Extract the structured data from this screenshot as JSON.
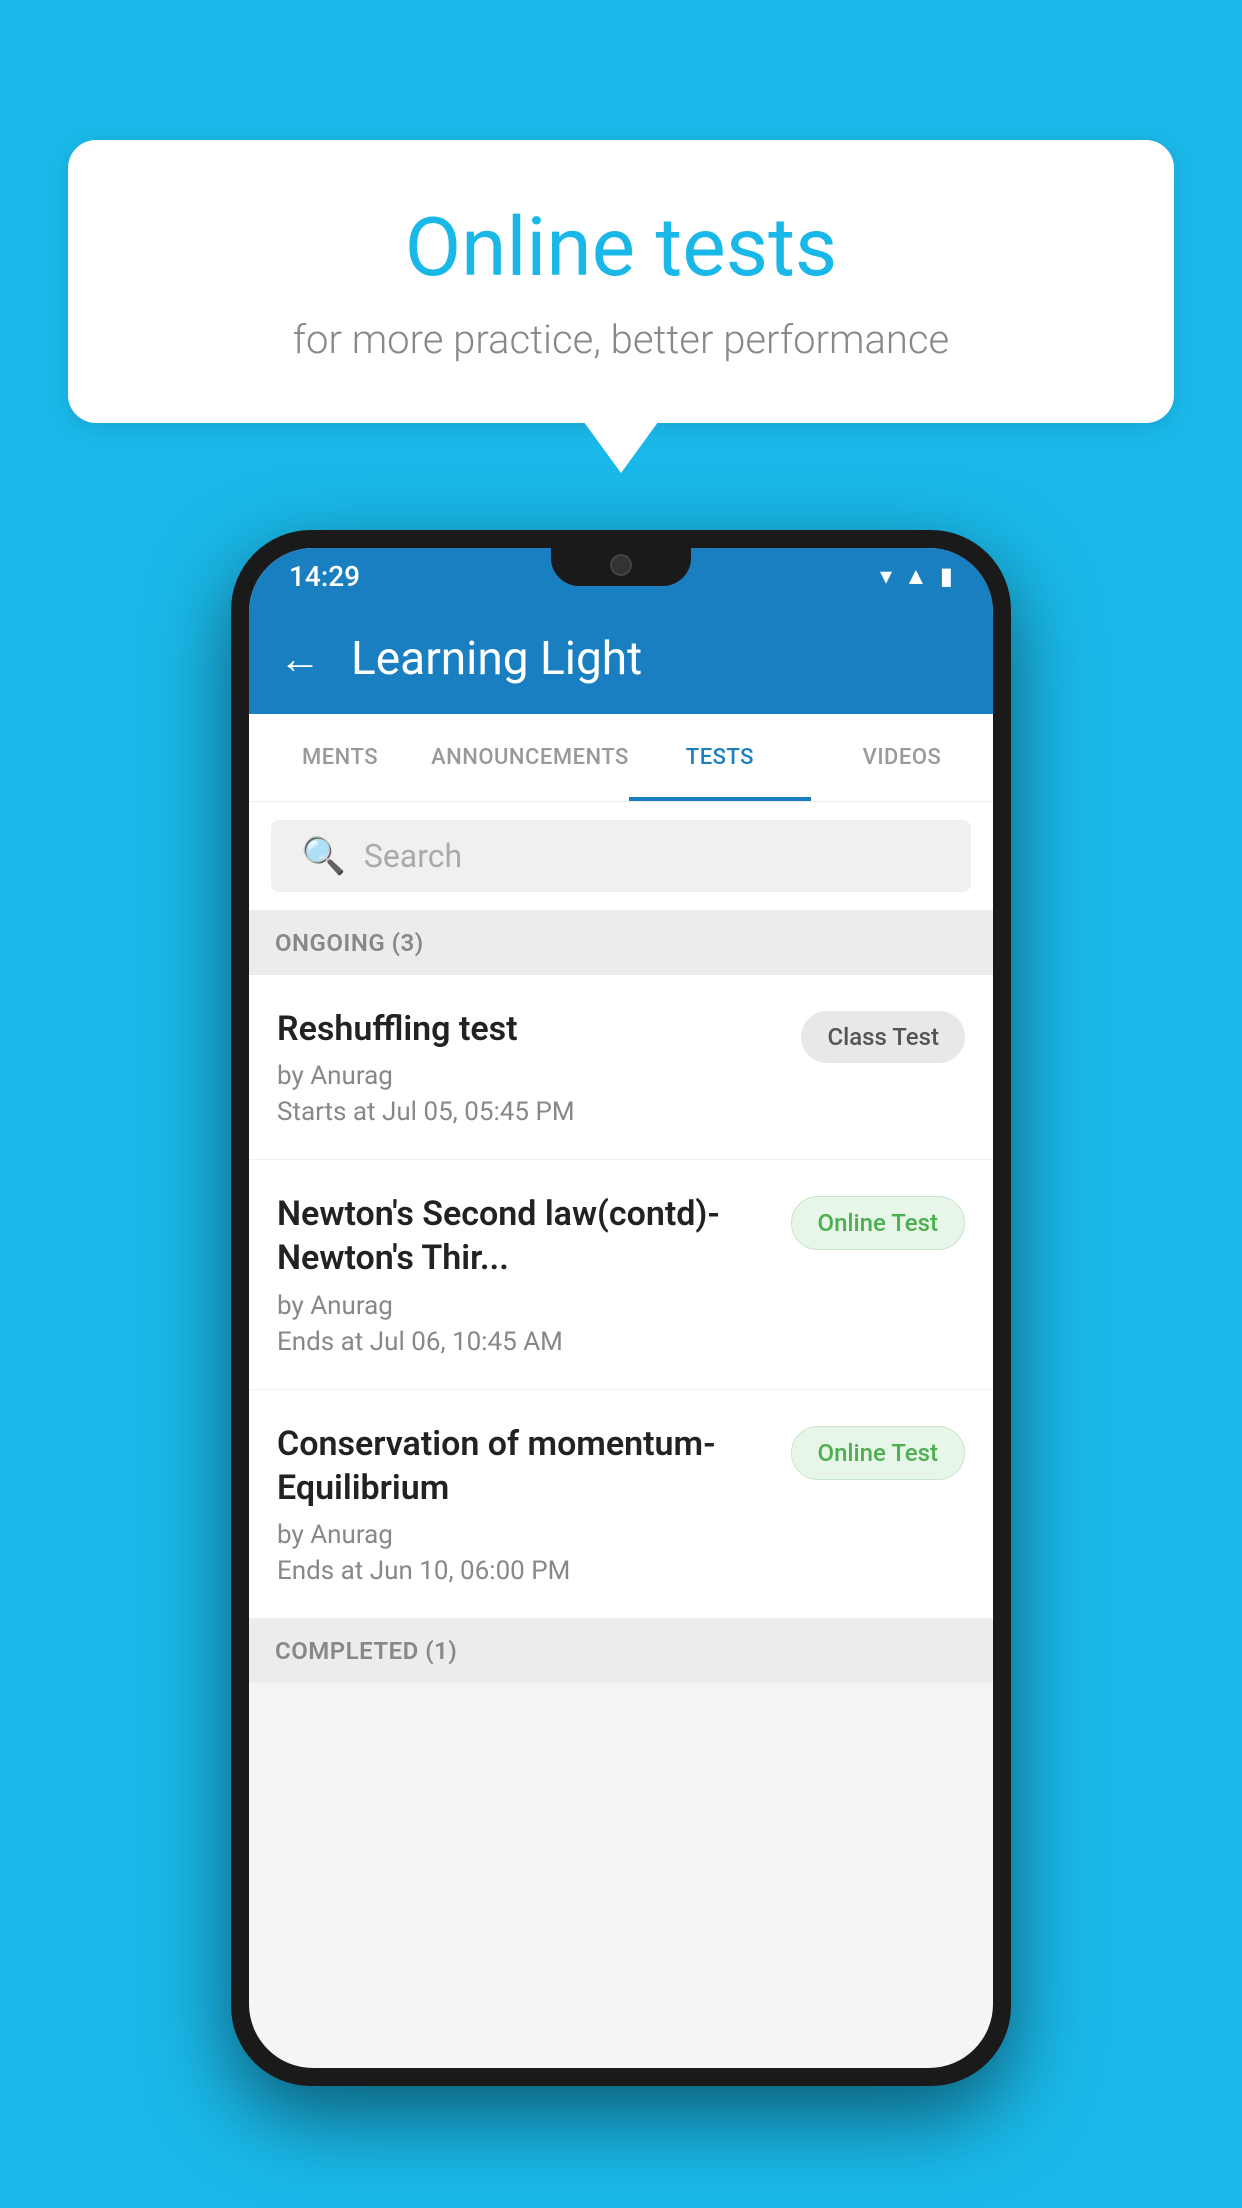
{
  "background": {
    "color": "#1ab8e8"
  },
  "speech_bubble": {
    "title": "Online tests",
    "subtitle": "for more practice, better performance"
  },
  "phone": {
    "status_bar": {
      "time": "14:29",
      "icons": [
        "wifi",
        "signal",
        "battery"
      ]
    },
    "app_bar": {
      "title": "Learning Light",
      "back_label": "←"
    },
    "tabs": [
      {
        "label": "MENTS",
        "active": false
      },
      {
        "label": "ANNOUNCEMENTS",
        "active": false
      },
      {
        "label": "TESTS",
        "active": true
      },
      {
        "label": "VIDEOS",
        "active": false
      }
    ],
    "search": {
      "placeholder": "Search"
    },
    "sections": [
      {
        "header": "ONGOING (3)",
        "items": [
          {
            "name": "Reshuffling test",
            "author": "by Anurag",
            "time": "Starts at  Jul 05, 05:45 PM",
            "badge": "Class Test",
            "badge_type": "class"
          },
          {
            "name": "Newton's Second law(contd)-Newton's Thir...",
            "author": "by Anurag",
            "time": "Ends at  Jul 06, 10:45 AM",
            "badge": "Online Test",
            "badge_type": "online"
          },
          {
            "name": "Conservation of momentum-Equilibrium",
            "author": "by Anurag",
            "time": "Ends at  Jun 10, 06:00 PM",
            "badge": "Online Test",
            "badge_type": "online"
          }
        ]
      },
      {
        "header": "COMPLETED (1)",
        "items": []
      }
    ]
  }
}
